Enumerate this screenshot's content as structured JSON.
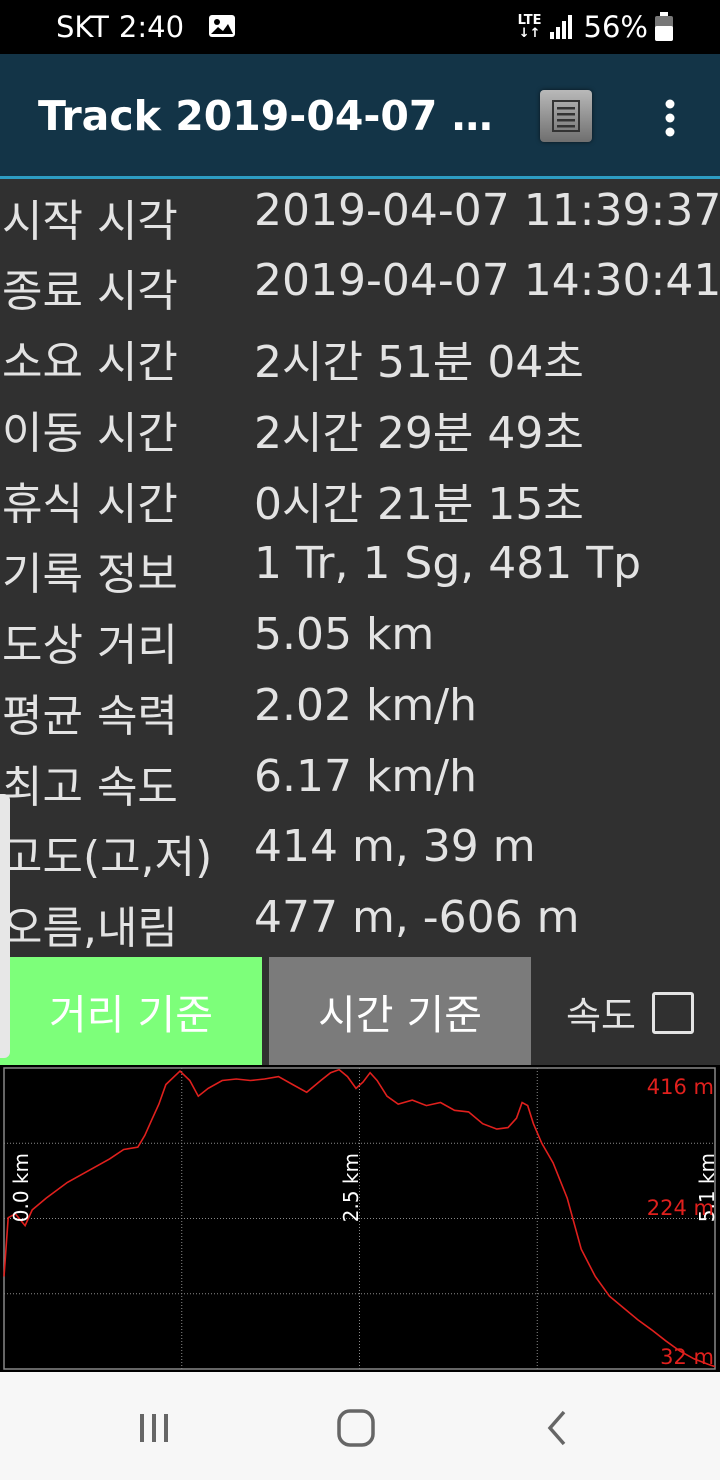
{
  "status_bar": {
    "carrier": "SKT",
    "time": "2:40",
    "network": "LTE",
    "battery": "56%"
  },
  "app_bar": {
    "title": "Track 2019-04-07 11..."
  },
  "stats": [
    {
      "label": "시작 시각",
      "value": "2019-04-07 11:39:37"
    },
    {
      "label": "종료 시각",
      "value": "2019-04-07 14:30:41"
    },
    {
      "label": "소요 시간",
      "value": "2시간 51분 04초"
    },
    {
      "label": "이동 시간",
      "value": "2시간 29분 49초"
    },
    {
      "label": "휴식 시간",
      "value": "0시간 21분 15초"
    },
    {
      "label": "기록 정보",
      "value": "1 Tr, 1 Sg, 481 Tp"
    },
    {
      "label": "도상 거리",
      "value": "5.05 km"
    },
    {
      "label": "평균 속력",
      "value": "2.02 km/h"
    },
    {
      "label": "최고 속도",
      "value": "6.17 km/h"
    },
    {
      "label": "고도(고,저)",
      "value": "414 m, 39 m"
    },
    {
      "label": "오름,내림",
      "value": "477 m, -606 m"
    }
  ],
  "buttons": {
    "distance_basis": "거리 기준",
    "time_basis": "시간 기준",
    "speed_label": "속도"
  },
  "colors": {
    "app_bar": "#133447",
    "accent_line": "#2d9cc3",
    "active_button": "#7dff7a",
    "inactive_button": "#7b7b7b",
    "panel": "#303030",
    "profile_line": "#e0201d"
  },
  "chart_data": {
    "type": "line",
    "x_unit": "km",
    "y_unit": "m",
    "xlim": [
      0,
      5.05
    ],
    "ylim": [
      32,
      416
    ],
    "x_tick_labels": [
      "0.0 km",
      "2.5 km",
      "5.1 km"
    ],
    "y_tick_labels": [
      "416 m",
      "224 m",
      "32 m"
    ],
    "grid": true,
    "series": [
      {
        "x": [
          0,
          0.03,
          0.08,
          0.15,
          0.2,
          0.3,
          0.45,
          0.6,
          0.75,
          0.85,
          0.95,
          1.0,
          1.05,
          1.1,
          1.15,
          1.25,
          1.32,
          1.38,
          1.45,
          1.55,
          1.65,
          1.75,
          1.85,
          1.95,
          2.05,
          2.15,
          2.25,
          2.32,
          2.38,
          2.44,
          2.5,
          2.55,
          2.6,
          2.65,
          2.72,
          2.8,
          2.9,
          3.0,
          3.1,
          3.2,
          3.3,
          3.4,
          3.5,
          3.58,
          3.64,
          3.68,
          3.72,
          3.76,
          3.82,
          3.9,
          4.0,
          4.1,
          4.2,
          4.3,
          4.4,
          4.5,
          4.6,
          4.7,
          4.8,
          4.9,
          5.0,
          5.05
        ],
        "y": [
          150,
          225,
          230,
          215,
          235,
          250,
          270,
          285,
          300,
          312,
          315,
          330,
          350,
          370,
          395,
          412,
          400,
          380,
          390,
          400,
          402,
          400,
          402,
          405,
          395,
          385,
          400,
          410,
          414,
          405,
          390,
          398,
          410,
          400,
          380,
          370,
          375,
          368,
          372,
          362,
          360,
          345,
          338,
          340,
          352,
          372,
          368,
          345,
          320,
          295,
          250,
          185,
          150,
          125,
          110,
          95,
          82,
          68,
          55,
          45,
          38,
          35
        ]
      }
    ]
  }
}
